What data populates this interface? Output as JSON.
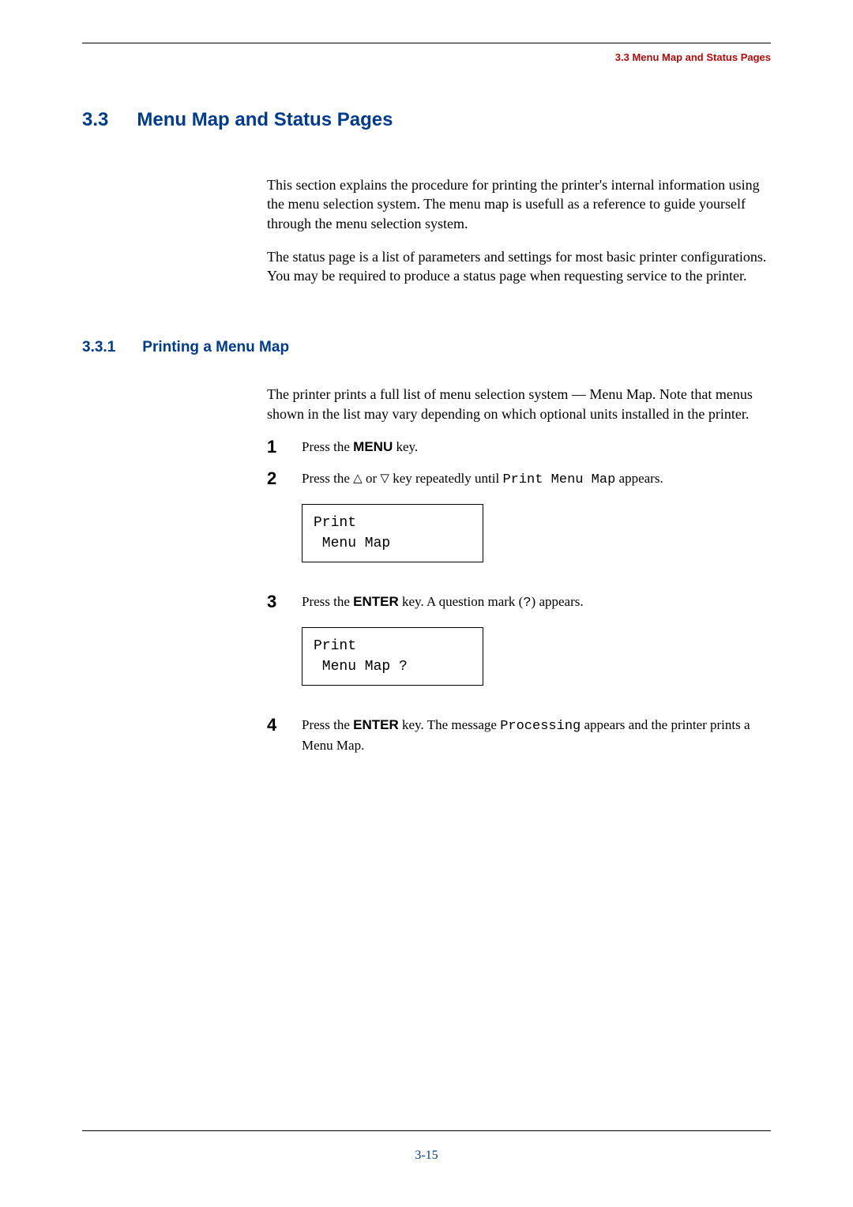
{
  "header": {
    "running_head": "3.3 Menu Map and Status Pages"
  },
  "section": {
    "number": "3.3",
    "title": "Menu Map and Status Pages",
    "intro_para_1": "This section explains the procedure for printing the printer's internal information using the menu selection system. The menu map is usefull as a reference to guide yourself through the menu selection system.",
    "intro_para_2": "The status page is a list of parameters and settings for most basic printer configurations. You may be required to produce a status page when requesting service to the printer."
  },
  "subsection": {
    "number": "3.3.1",
    "title": "Printing a Menu Map",
    "intro": "The printer prints a full list of menu selection system — Menu Map. Note that menus shown in the list may vary depending on which optional units installed in the printer."
  },
  "steps": {
    "s1": {
      "num": "1",
      "pre": "Press the ",
      "key": "MENU",
      "post": " key."
    },
    "s2": {
      "num": "2",
      "pre": "Press the ",
      "tri_up": "△",
      "or": " or ",
      "tri_down": "▽",
      "mid": " key repeatedly until ",
      "mono": "Print Menu Map",
      "post": " appears.",
      "display": "Print\n Menu Map"
    },
    "s3": {
      "num": "3",
      "pre": "Press the ",
      "key": "ENTER",
      "mid": " key. A question mark (",
      "qmark": "?",
      "post": ") appears.",
      "display": "Print\n Menu Map ?"
    },
    "s4": {
      "num": "4",
      "pre": "Press the ",
      "key": "ENTER",
      "mid": " key. The message ",
      "mono": "Processing",
      "post": " appears and the printer prints a Menu Map."
    }
  },
  "footer": {
    "page_number": "3-15"
  }
}
